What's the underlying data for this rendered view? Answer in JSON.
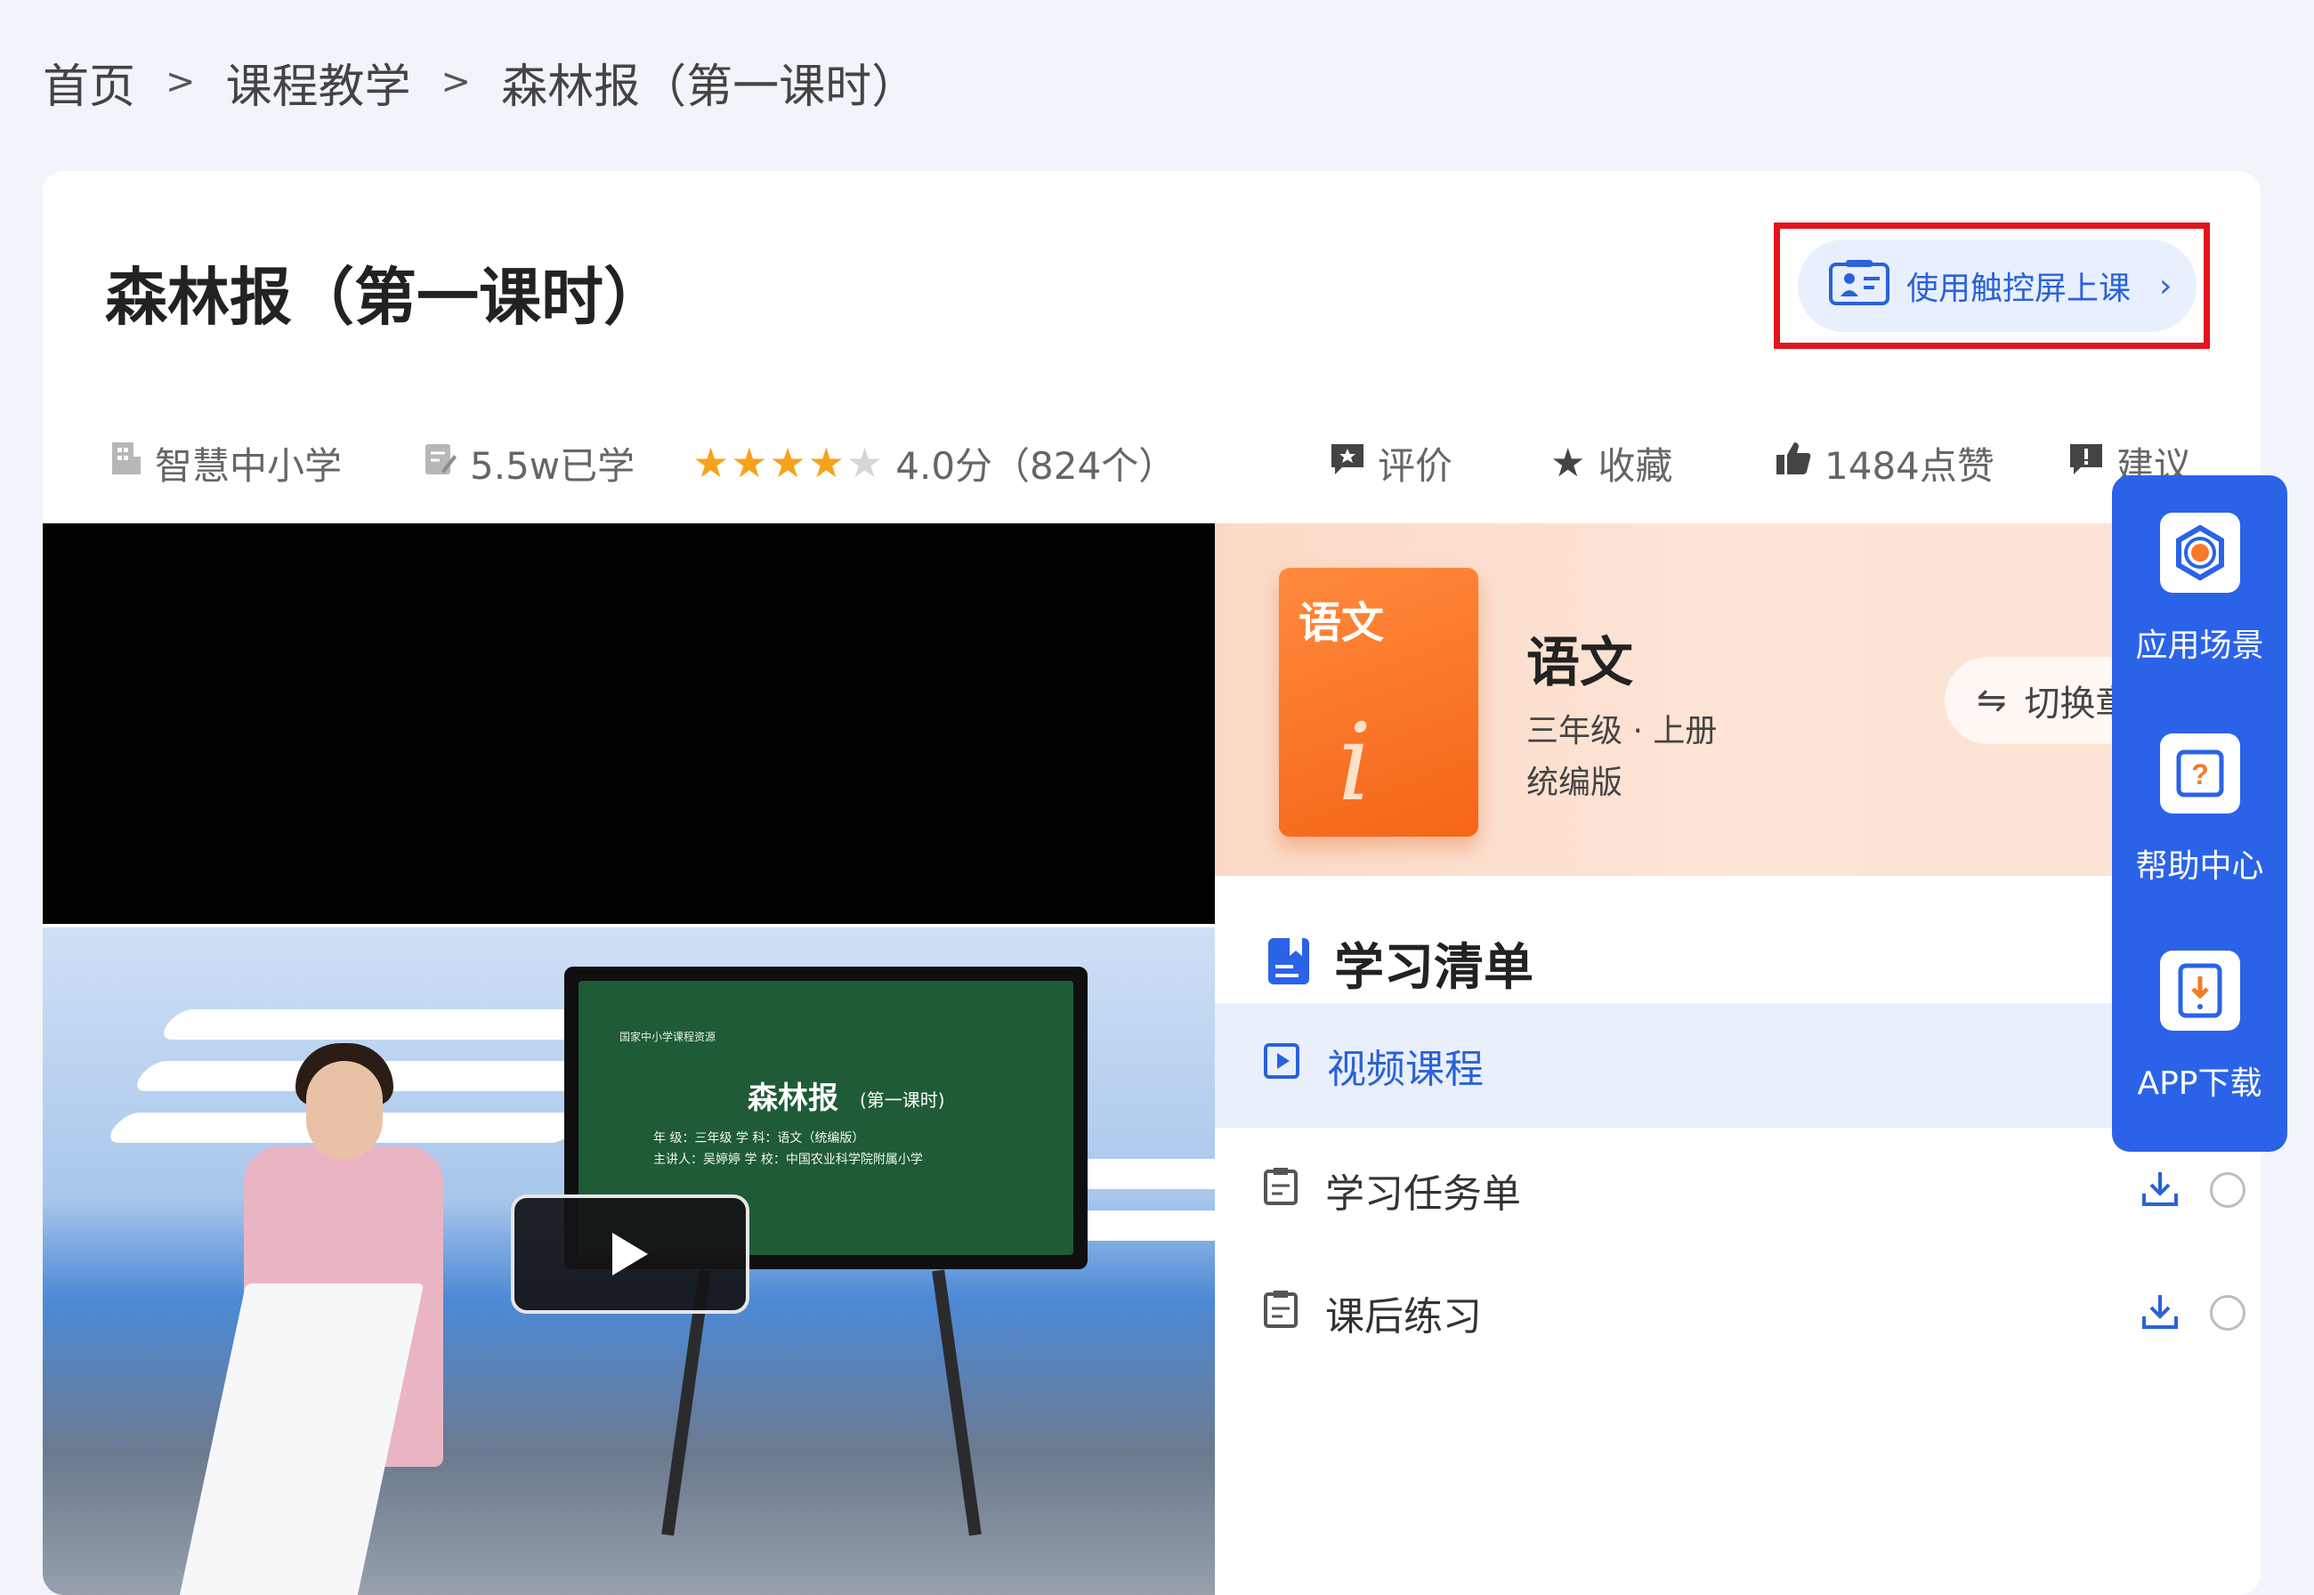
{
  "breadcrumb": {
    "items": [
      "首页",
      "课程教学",
      "森林报（第一课时）"
    ],
    "separator": ">"
  },
  "lesson": {
    "title": "森林报（第一课时）",
    "touch_button": "使用触控屏上课"
  },
  "meta": {
    "source": "智慧中小学",
    "learned": "5.5w已学",
    "rating_text": "4.0分（824个）",
    "rating_value": 4.0,
    "rating_max": 5,
    "review": "评价",
    "favorite": "收藏",
    "likes": "1484点赞",
    "suggest": "建议"
  },
  "video": {
    "board_small": "国家中小学课程资源",
    "board_title": "森林报",
    "board_sub": "(第一课时)",
    "board_line1": "年  级：三年级      学  科：语文（统编版）",
    "board_line2": "主讲人：吴婷婷      学  校：中国农业科学院附属小学"
  },
  "subject": {
    "book_title": "语文",
    "name": "语文",
    "grade": "三年级 · 上册",
    "edition": "统编版",
    "switch_label": "切换章"
  },
  "study_list": {
    "heading": "学习清单",
    "items": [
      {
        "label": "视频课程",
        "active": true
      },
      {
        "label": "学习任务单",
        "active": false
      },
      {
        "label": "课后练习",
        "active": false
      }
    ]
  },
  "float_menu": {
    "items": [
      "应用场景",
      "帮助中心",
      "APP下载"
    ]
  },
  "colors": {
    "accent": "#2a62d9",
    "float_bg": "#2b63e8",
    "highlight_border": "#e1141c",
    "star": "#f7a21b"
  }
}
